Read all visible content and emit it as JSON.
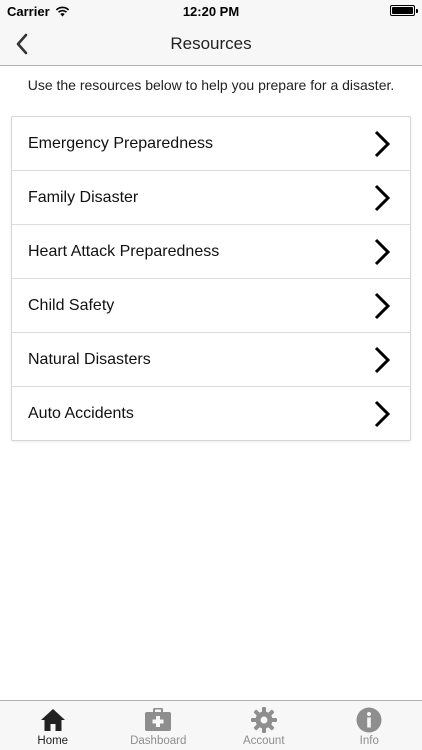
{
  "status_bar": {
    "carrier": "Carrier",
    "time": "12:20 PM"
  },
  "nav": {
    "title": "Resources",
    "back_icon": "chevron-left-icon"
  },
  "intro_text": "Use the resources below to help you prepare for a disaster.",
  "resources": [
    {
      "label": "Emergency Preparedness"
    },
    {
      "label": "Family Disaster"
    },
    {
      "label": "Heart Attack Preparedness"
    },
    {
      "label": "Child Safety"
    },
    {
      "label": "Natural Disasters"
    },
    {
      "label": "Auto Accidents"
    }
  ],
  "tabs": [
    {
      "label": "Home",
      "icon": "home-icon",
      "active": true
    },
    {
      "label": "Dashboard",
      "icon": "first-aid-kit-icon",
      "active": false
    },
    {
      "label": "Account",
      "icon": "gear-icon",
      "active": false
    },
    {
      "label": "Info",
      "icon": "info-icon",
      "active": false
    }
  ],
  "colors": {
    "bar_background": "#f7f7f7",
    "active_icon": "#222222",
    "inactive_icon": "#8e8e8e"
  }
}
